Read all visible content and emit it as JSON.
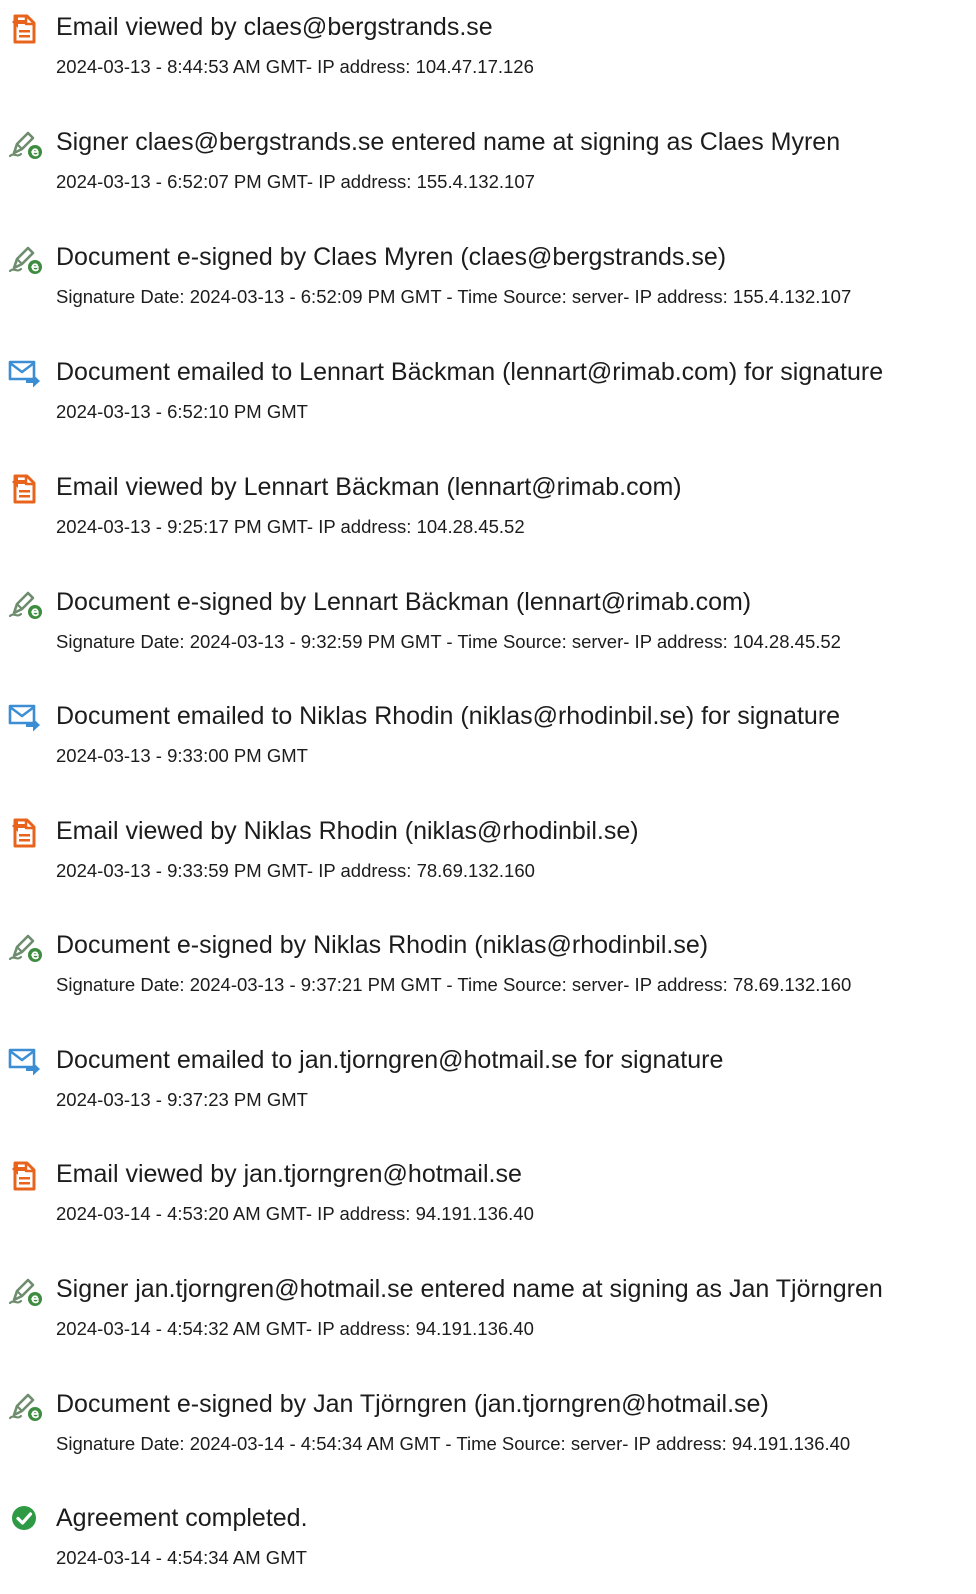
{
  "colors": {
    "viewed": "#e8641c",
    "signed": "#3d8c3f",
    "emailed": "#3b8ed4",
    "completed": "#2e9a44"
  },
  "events": [
    {
      "icon": "document-viewed-icon",
      "title": "Email viewed by claes@bergstrands.se",
      "detail": "2024-03-13 - 8:44:53 AM GMT- IP address: 104.47.17.126"
    },
    {
      "icon": "pen-signer-icon",
      "title": "Signer claes@bergstrands.se entered name at signing as Claes Myren",
      "detail": "2024-03-13 - 6:52:07 PM GMT- IP address: 155.4.132.107"
    },
    {
      "icon": "pen-signer-icon",
      "title": "Document e-signed by Claes Myren (claes@bergstrands.se)",
      "detail": "Signature Date: 2024-03-13 - 6:52:09 PM GMT - Time Source: server- IP address: 155.4.132.107"
    },
    {
      "icon": "email-send-icon",
      "title": "Document emailed to Lennart Bäckman (lennart@rimab.com) for signature",
      "detail": "2024-03-13 - 6:52:10 PM GMT"
    },
    {
      "icon": "document-viewed-icon",
      "title": "Email viewed by Lennart Bäckman (lennart@rimab.com)",
      "detail": "2024-03-13 - 9:25:17 PM GMT- IP address: 104.28.45.52"
    },
    {
      "icon": "pen-signer-icon",
      "title": "Document e-signed by Lennart Bäckman (lennart@rimab.com)",
      "detail": "Signature Date: 2024-03-13 - 9:32:59 PM GMT - Time Source: server- IP address: 104.28.45.52"
    },
    {
      "icon": "email-send-icon",
      "title": "Document emailed to Niklas Rhodin (niklas@rhodinbil.se) for signature",
      "detail": "2024-03-13 - 9:33:00 PM GMT"
    },
    {
      "icon": "document-viewed-icon",
      "title": "Email viewed by Niklas Rhodin (niklas@rhodinbil.se)",
      "detail": "2024-03-13 - 9:33:59 PM GMT- IP address: 78.69.132.160"
    },
    {
      "icon": "pen-signer-icon",
      "title": "Document e-signed by Niklas Rhodin (niklas@rhodinbil.se)",
      "detail": "Signature Date: 2024-03-13 - 9:37:21 PM GMT - Time Source: server- IP address: 78.69.132.160"
    },
    {
      "icon": "email-send-icon",
      "title": "Document emailed to jan.tjorngren@hotmail.se for signature",
      "detail": "2024-03-13 - 9:37:23 PM GMT"
    },
    {
      "icon": "document-viewed-icon",
      "title": "Email viewed by jan.tjorngren@hotmail.se",
      "detail": "2024-03-14 - 4:53:20 AM GMT- IP address: 94.191.136.40"
    },
    {
      "icon": "pen-signer-icon",
      "title": "Signer jan.tjorngren@hotmail.se entered name at signing as Jan Tjörngren",
      "detail": "2024-03-14 - 4:54:32 AM GMT- IP address: 94.191.136.40"
    },
    {
      "icon": "pen-signer-icon",
      "title": "Document e-signed by Jan Tjörngren (jan.tjorngren@hotmail.se)",
      "detail": "Signature Date: 2024-03-14 - 4:54:34 AM GMT - Time Source: server- IP address: 94.191.136.40"
    },
    {
      "icon": "check-circle-icon",
      "title": "Agreement completed.",
      "detail": "2024-03-14 - 4:54:34 AM GMT"
    }
  ]
}
